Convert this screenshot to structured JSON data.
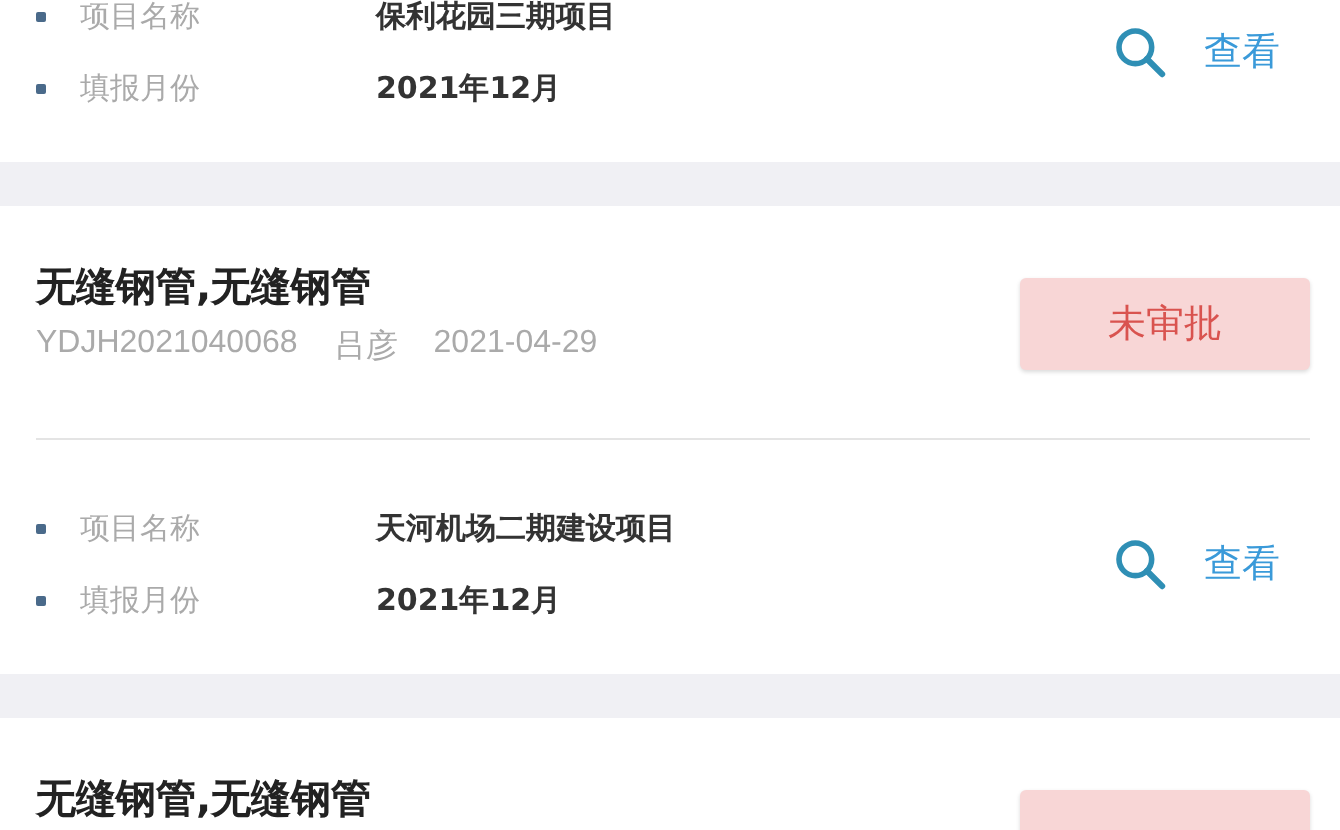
{
  "cards": [
    {
      "details": [
        {
          "label": "项目名称",
          "value": "保利花园三期项目"
        },
        {
          "label": "填报月份",
          "value": "2021年12月"
        }
      ],
      "view": "查看"
    },
    {
      "title": "无缝钢管,无缝钢管",
      "meta": [
        "YDJH2021040068",
        "吕彦",
        "2021-04-29"
      ],
      "status": {
        "kind": "pending",
        "label": "未审批"
      },
      "details": [
        {
          "label": "项目名称",
          "value": "天河机场二期建设项目"
        },
        {
          "label": "填报月份",
          "value": "2021年12月"
        }
      ],
      "view": "查看"
    },
    {
      "title": "无缝钢管,无缝钢管",
      "status": {
        "kind": "pending"
      }
    }
  ]
}
